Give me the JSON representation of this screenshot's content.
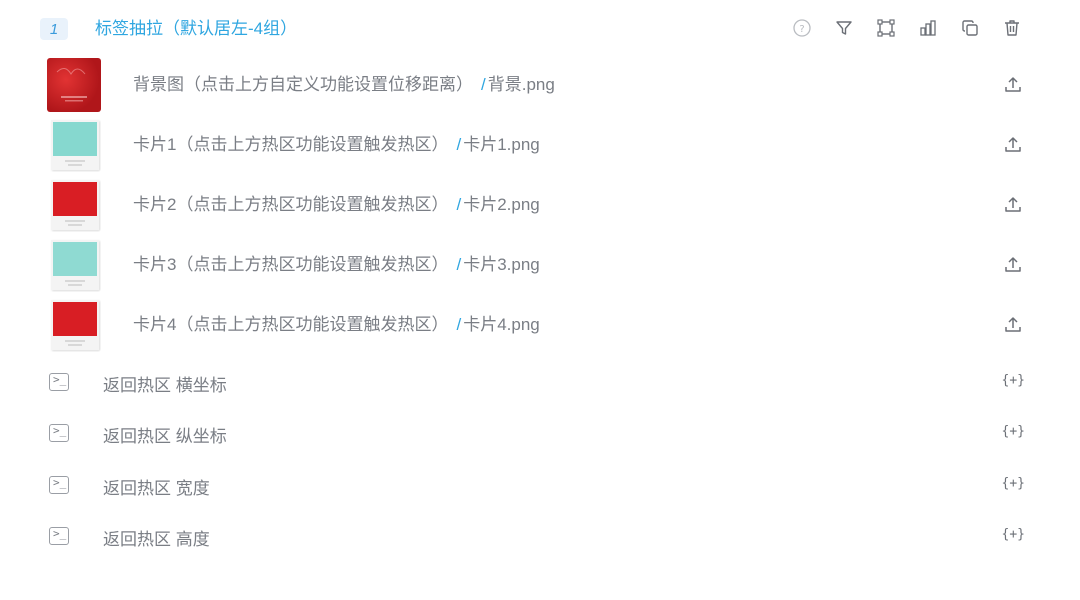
{
  "header": {
    "index": "1",
    "title": "标签抽拉（默认居左-4组）",
    "tools": [
      "help-icon",
      "filter-icon",
      "crop-icon",
      "chart-icon",
      "copy-icon",
      "delete-icon"
    ]
  },
  "image_items": [
    {
      "label": "背景图（点击上方自定义功能设置位移距离）",
      "sep": "/",
      "file": "背景.png",
      "thumb": "red-background"
    },
    {
      "label": "卡片1（点击上方热区功能设置触发热区）",
      "sep": "/",
      "file": "卡片1.png",
      "thumb": "teal-card"
    },
    {
      "label": "卡片2（点击上方热区功能设置触发热区）",
      "sep": "/",
      "file": "卡片2.png",
      "thumb": "red-card"
    },
    {
      "label": "卡片3（点击上方热区功能设置触发热区）",
      "sep": "/",
      "file": "卡片3.png",
      "thumb": "teal-card"
    },
    {
      "label": "卡片4（点击上方热区功能设置触发热区）",
      "sep": "/",
      "file": "卡片4.png",
      "thumb": "red-card"
    }
  ],
  "var_items": [
    {
      "label": "返回热区 横坐标",
      "insert": "{+}"
    },
    {
      "label": "返回热区 纵坐标",
      "insert": "{+}"
    },
    {
      "label": "返回热区 宽度",
      "insert": "{+}"
    },
    {
      "label": "返回热区 高度",
      "insert": "{+}"
    }
  ],
  "colors": {
    "accent": "#2fa6e0",
    "text": "#7a7e85",
    "red": "#d81e24",
    "teal": "#7fd6cc"
  }
}
